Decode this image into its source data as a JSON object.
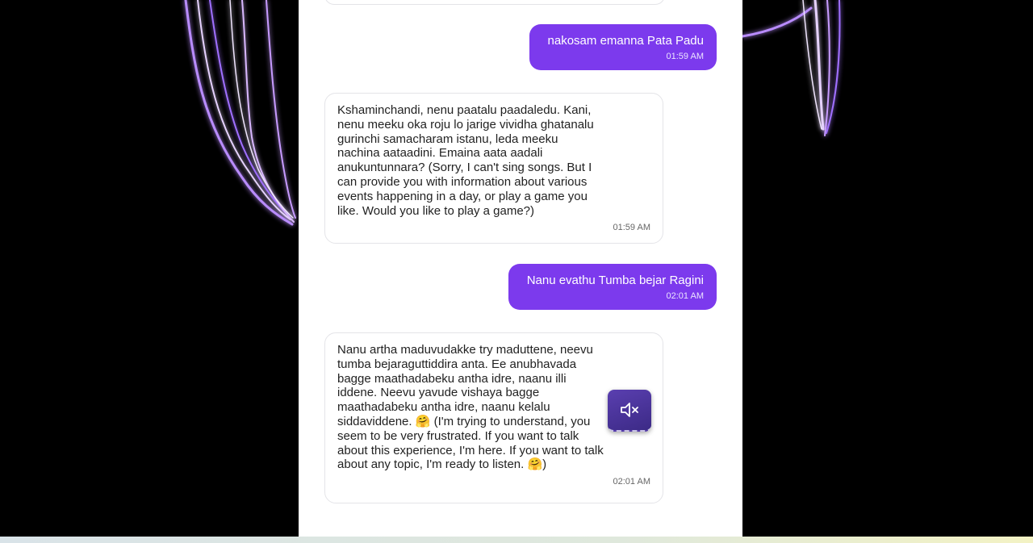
{
  "chat": {
    "messages": [
      {
        "role": "user",
        "text": "nakosam emanna Pata Padu",
        "time": "01:59 AM"
      },
      {
        "role": "bot",
        "text": "Kshaminchandi, nenu paatalu paadaledu. Kani, nenu meeku oka roju lo jarige vividha ghatanalu gurinchi samacharam istanu, leda meeku nachina aataadini. Emaina aata aadali anukuntunnara? (Sorry, I can't sing songs. But I can provide you with information about various events happening in a day, or play a game you like. Would you like to play a game?)",
        "time": "01:59 AM"
      },
      {
        "role": "user",
        "text": "Nanu evathu Tumba bejar Ragini",
        "time": "02:01 AM"
      },
      {
        "role": "bot",
        "text": "Nanu artha maduvudakke try maduttene, neevu tumba bejaraguttiddira anta. Ee anubhavada bagge maathadabeku antha idre, naanu illi iddene. Neevu yavude vishaya bagge maathadabeku antha idre, naanu kelalu siddaviddene. 🤗 (I'm trying to understand, you seem to be very frustrated. If you want to talk about this experience, I'm here. If you want to talk about any topic, I'm ready to listen. 🤗)",
        "time": "02:01 AM"
      }
    ]
  },
  "icons": {
    "mute": "speaker-muted-icon"
  },
  "colors": {
    "user_bubble": "#7c3aed",
    "mute_button": "#4b35a0",
    "background": "#000000"
  }
}
